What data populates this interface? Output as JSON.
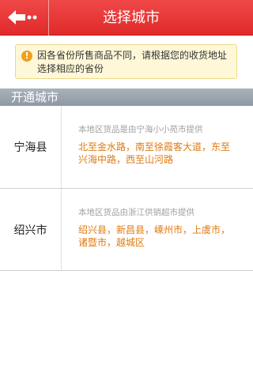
{
  "header": {
    "title": "选择城市",
    "back_icon": "back-arrow-icon"
  },
  "notice": {
    "icon": "info-icon",
    "icon_glyph": "!",
    "text": "因各省份所售商品不同，请根据您的收货地址选择相应的省份"
  },
  "section": {
    "title": "开通城市"
  },
  "cities": [
    {
      "name": "宁海县",
      "provider": "本地区货品是由宁海小小苑市提供",
      "areas": "北至金水路，南至徐霞客大道，东至兴海中路，西至山河路"
    },
    {
      "name": "绍兴市",
      "provider": "本地区货品由浙江供销超市提供",
      "areas": "绍兴县，新昌县，嵊州市，上虞市，诸暨市，越城区"
    }
  ],
  "colors": {
    "header_bg": "#e83434",
    "accent_text": "#e07a10",
    "section_bg": "#9aa3ad",
    "notice_bg": "#fff8d8"
  }
}
